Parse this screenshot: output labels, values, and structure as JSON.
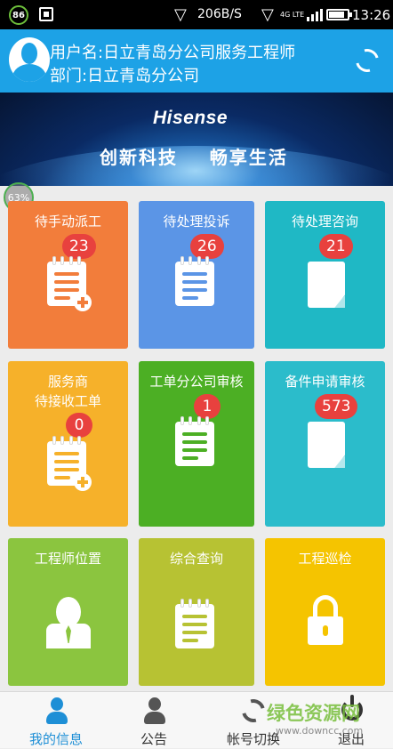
{
  "status_bar": {
    "left_badge": "86",
    "net_speed": "206B/S",
    "network_type": "4G LTE",
    "time": "13:26"
  },
  "header": {
    "username": "用户名:日立青岛分公司服务工程师",
    "department": "部门:日立青岛分公司"
  },
  "banner": {
    "brand": "Hisense",
    "slogan": "创新科技    畅享生活"
  },
  "overlay_percent": "63%",
  "tiles": [
    {
      "label": "待手动派工",
      "count": "23",
      "icon": "notepad-add-icon",
      "color": "#f27d3b"
    },
    {
      "label": "待处理投诉",
      "count": "26",
      "icon": "notepad-icon",
      "color": "#5b95e6"
    },
    {
      "label": "待处理咨询",
      "count": "21",
      "icon": "document-icon",
      "color": "#1fb8c5"
    },
    {
      "label": "服务商\n待接收工单",
      "count": "0",
      "icon": "notepad-add-icon",
      "color": "#f6b12a"
    },
    {
      "label": "工单分公司审核",
      "count": "1",
      "icon": "notepad-icon",
      "color": "#4caf24"
    },
    {
      "label": "备件申请审核",
      "count": "573",
      "icon": "document-icon",
      "color": "#2bbccb"
    },
    {
      "label": "工程师位置",
      "count": "",
      "icon": "engineer-person-icon",
      "color": "#8bc53f"
    },
    {
      "label": "综合查询",
      "count": "",
      "icon": "notepad-icon",
      "color": "#b7c233"
    },
    {
      "label": "工程巡检",
      "count": "",
      "icon": "lock-icon",
      "color": "#f5c400"
    }
  ],
  "tabbar": {
    "items": [
      {
        "label": "我的信息",
        "icon": "user-icon",
        "active": true
      },
      {
        "label": "公告",
        "icon": "person-icon",
        "active": false
      },
      {
        "label": "帐号切换",
        "icon": "switch-icon",
        "active": false
      },
      {
        "label": "退出",
        "icon": "power-icon",
        "active": false
      }
    ]
  },
  "watermark": {
    "text": "绿色资源网",
    "url": "www.downcc.com"
  },
  "colors": {
    "header": "#1da2e6",
    "badge": "#e8413e",
    "active_tab": "#1e8fd6"
  }
}
